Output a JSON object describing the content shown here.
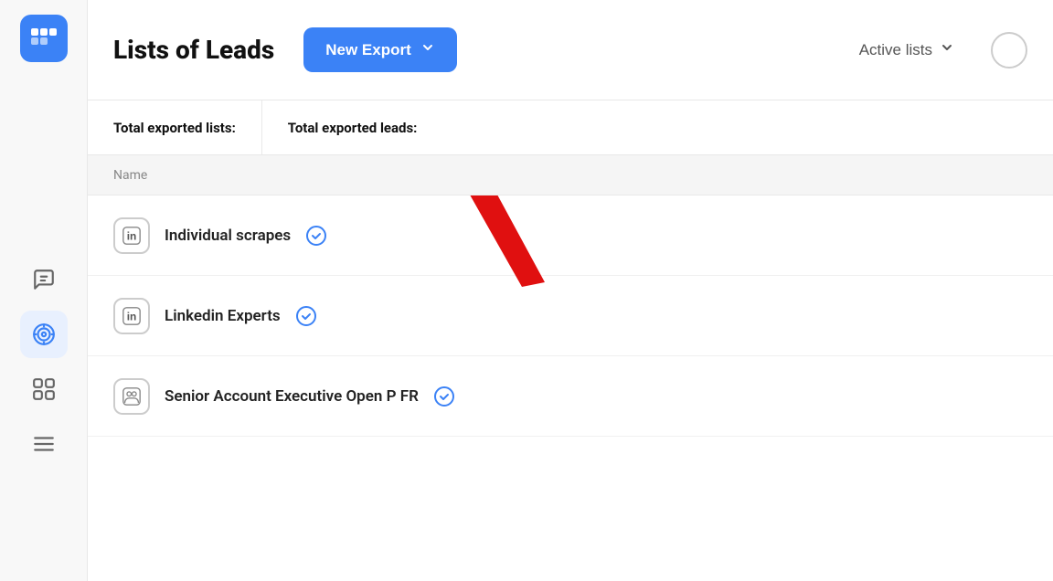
{
  "sidebar": {
    "logo_alt": "Waalaxy logo",
    "nav_items": [
      {
        "id": "messages",
        "icon": "message-icon",
        "active": false
      },
      {
        "id": "targeting",
        "icon": "target-icon",
        "active": true
      },
      {
        "id": "sequences",
        "icon": "grid-icon",
        "active": false
      },
      {
        "id": "list",
        "icon": "list-icon",
        "active": false
      }
    ]
  },
  "header": {
    "title": "Lists of Leads",
    "new_export_label": "New Export",
    "active_lists_label": "Active lists"
  },
  "stats": {
    "total_exported_lists_label": "Total exported lists:",
    "total_exported_leads_label": "Total exported leads:"
  },
  "table": {
    "name_column": "Name"
  },
  "list_items": [
    {
      "id": 1,
      "name": "Individual scrapes",
      "icon_type": "linkedin",
      "has_check": true
    },
    {
      "id": 2,
      "name": "Linkedin Experts",
      "icon_type": "linkedin",
      "has_check": true
    },
    {
      "id": 3,
      "name": "Senior Account Executive Open P FR",
      "icon_type": "people",
      "has_check": true
    }
  ],
  "colors": {
    "accent_blue": "#3b82f6",
    "arrow_red": "#e01010"
  }
}
